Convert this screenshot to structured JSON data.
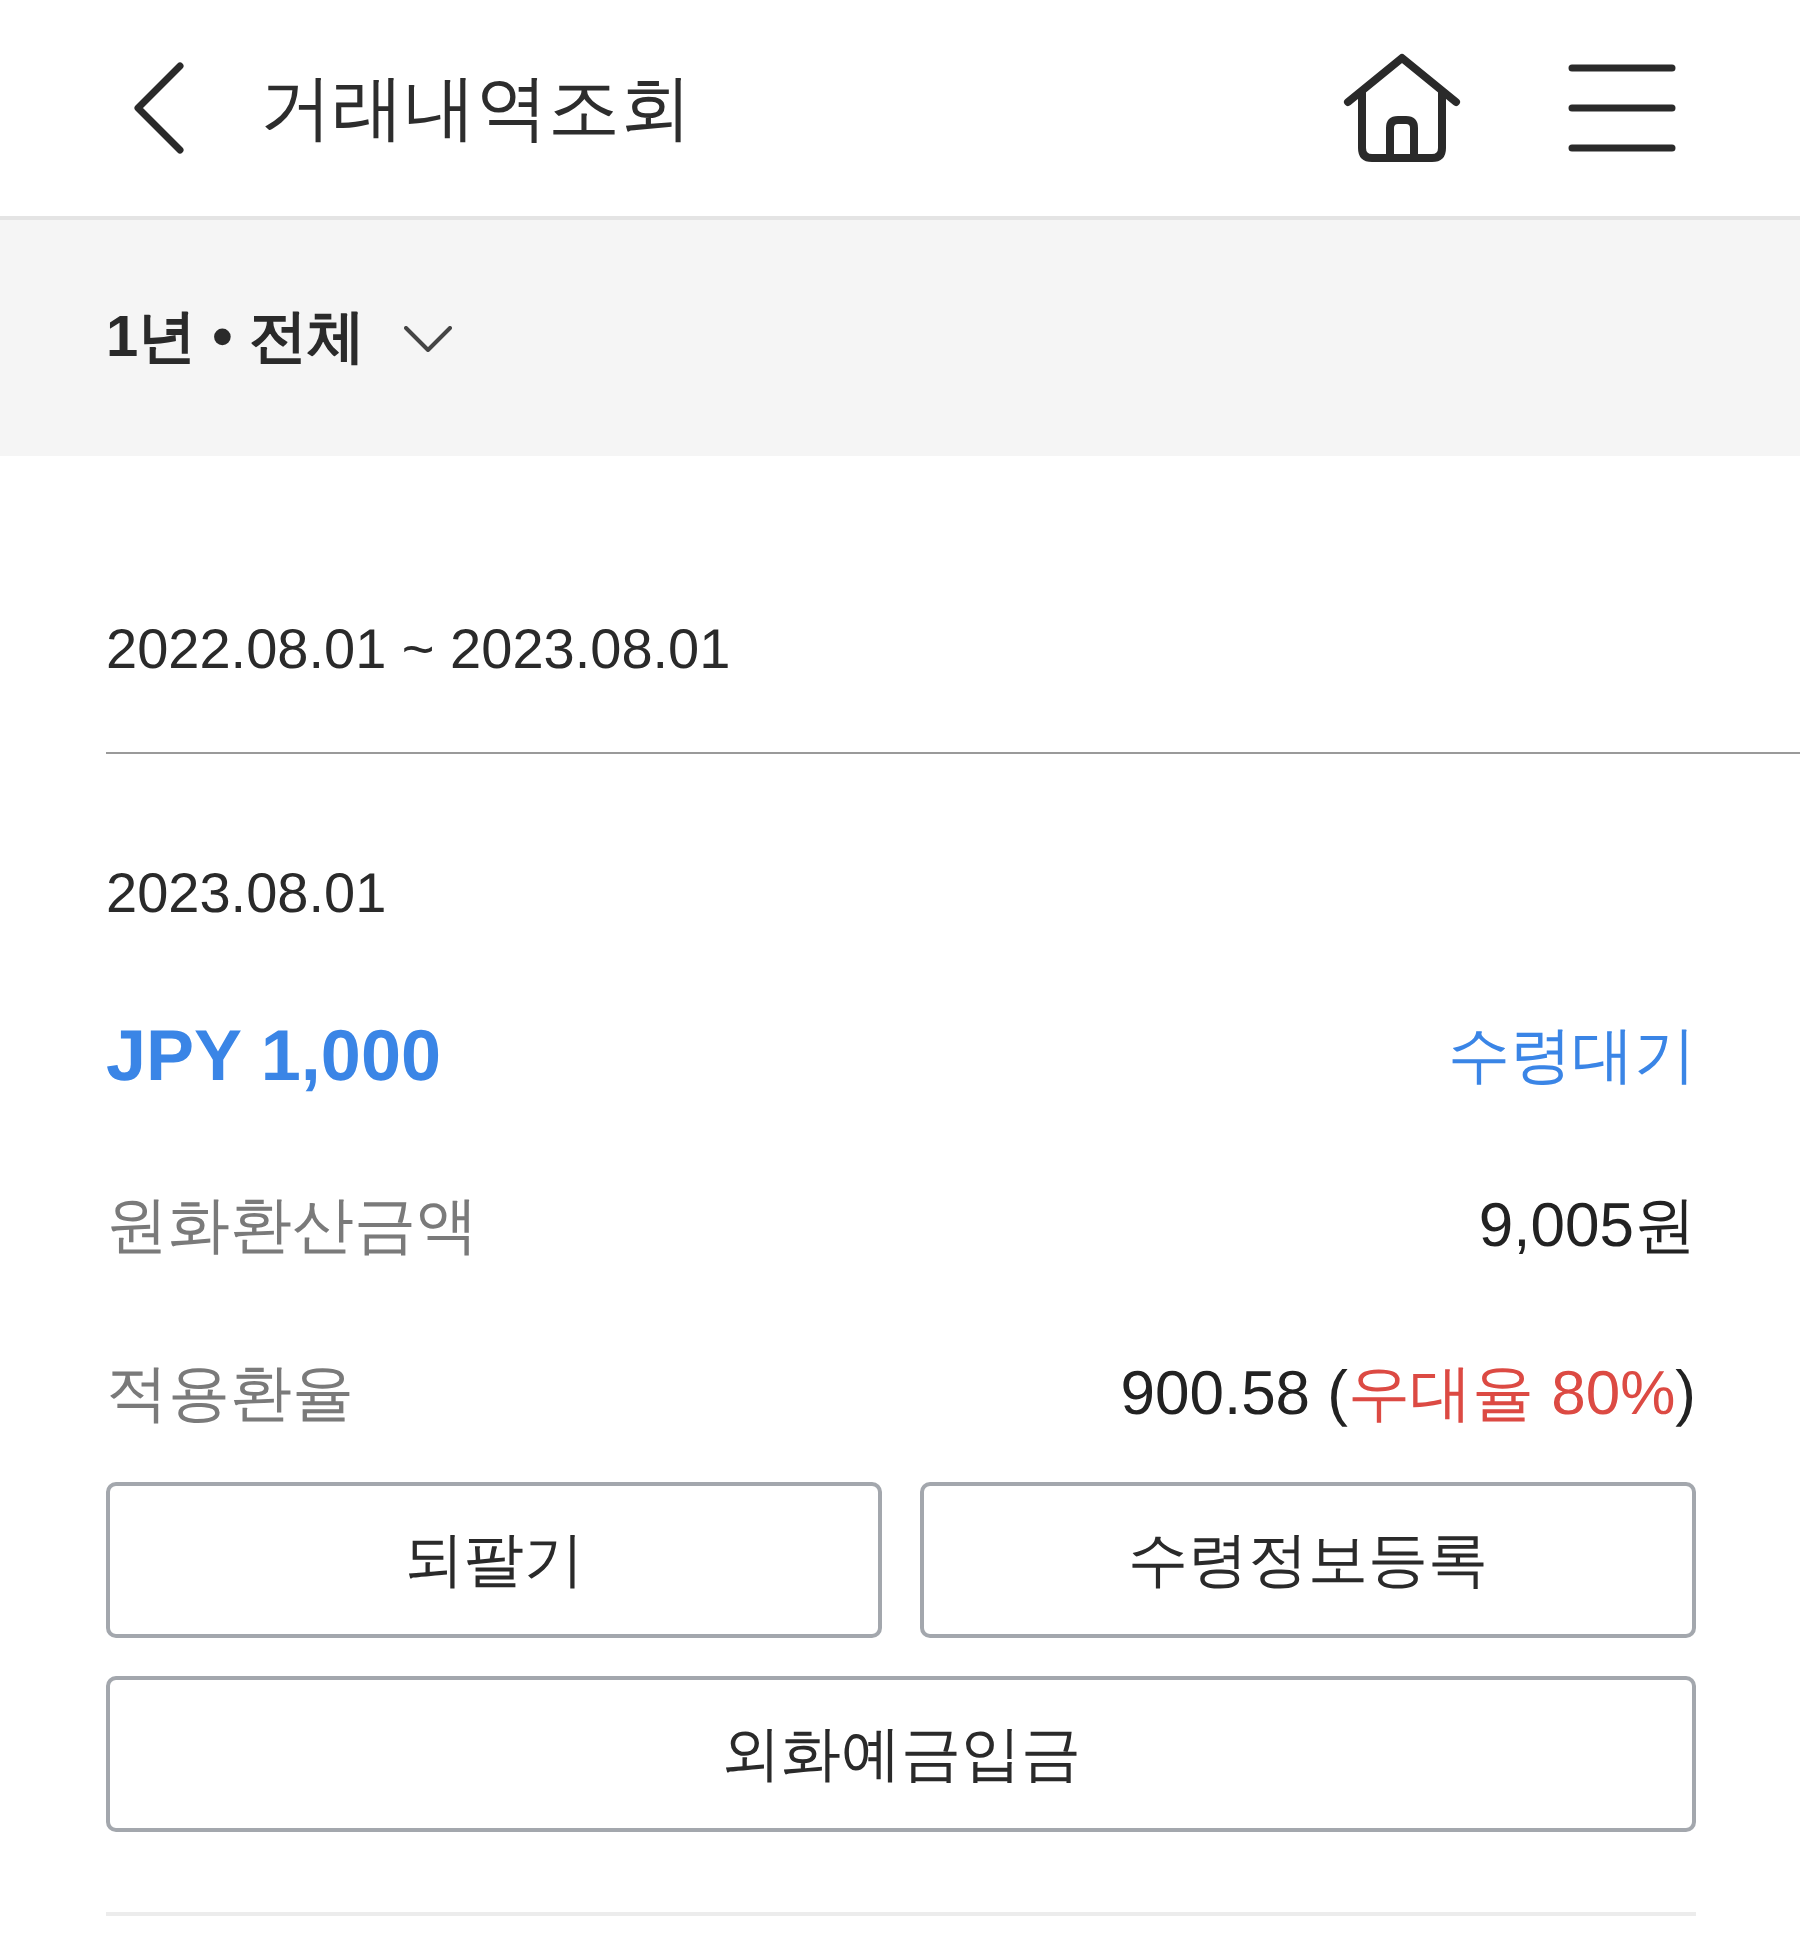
{
  "header": {
    "title": "거래내역조회"
  },
  "filter": {
    "label": "1년 • 전체"
  },
  "period": "2022.08.01 ~ 2023.08.01",
  "transactions": [
    {
      "date": "2023.08.01",
      "amount": "JPY 1,000",
      "status": "수령대기",
      "details": [
        {
          "label": "원화환산금액",
          "value_parts": [
            {
              "text": "9,005원",
              "highlight": false
            }
          ]
        },
        {
          "label": "적용환율",
          "value_parts": [
            {
              "text": "900.58 (",
              "highlight": false
            },
            {
              "text": "우대율 80%",
              "highlight": true
            },
            {
              "text": ")",
              "highlight": false
            }
          ]
        }
      ],
      "action_rows": [
        [
          "되팔기",
          "수령정보등록"
        ],
        [
          "외화예금입금"
        ]
      ]
    }
  ]
}
